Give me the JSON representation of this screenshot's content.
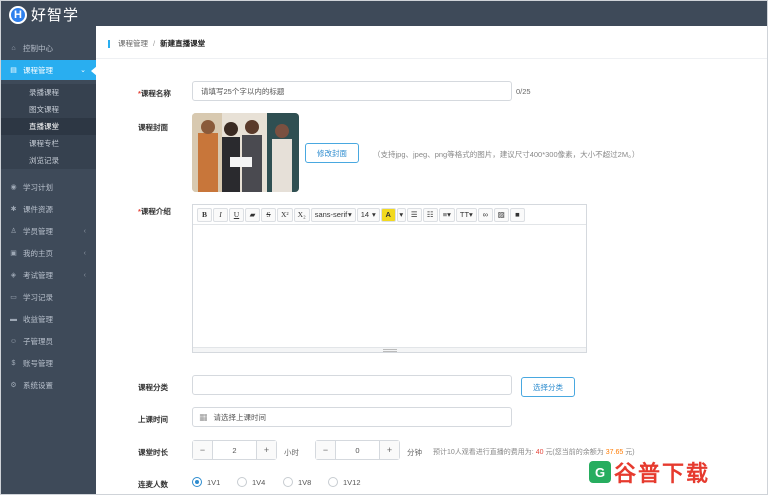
{
  "app": {
    "logo_letter": "H",
    "logo_text": "好智学"
  },
  "sidebar": {
    "items": [
      {
        "label": "控制中心",
        "icon": "home-icon"
      },
      {
        "label": "课程管理",
        "icon": "book-icon",
        "active": true
      },
      {
        "label": "学习计划",
        "icon": "eye-icon"
      },
      {
        "label": "课件资源",
        "icon": "gear-icon"
      },
      {
        "label": "学员管理",
        "icon": "user-icon"
      },
      {
        "label": "我的主页",
        "icon": "page-icon"
      },
      {
        "label": "考试管理",
        "icon": "tag-icon"
      },
      {
        "label": "学习记录",
        "icon": "monitor-icon"
      },
      {
        "label": "收益管理",
        "icon": "card-icon"
      },
      {
        "label": "子管理员",
        "icon": "person-icon"
      },
      {
        "label": "账号管理",
        "icon": "dollar-icon"
      },
      {
        "label": "系统设置",
        "icon": "settings-icon"
      }
    ],
    "subitems": [
      "录播课程",
      "图文课程",
      "直播课堂",
      "课程专栏",
      "浏览记录"
    ],
    "selected_sub": "直播课堂"
  },
  "breadcrumb": {
    "parent": "课程管理",
    "separator": "/",
    "current": "新建直播课堂"
  },
  "form": {
    "name_label": "*课程名称",
    "name_placeholder": "请填写25个字以内的标题",
    "name_count": "0/25",
    "cover_label": "课程封面",
    "cover_button": "修改封面",
    "cover_hint": "（支持jpg、jpeg、png等格式的图片，建议尺寸400*300像素，大小不超过2M。）",
    "intro_label": "*课程介绍",
    "toolbar": {
      "bold": "B",
      "italic": "I",
      "underline": "U",
      "eraser": "▰",
      "strike": "S",
      "sup": "X²",
      "sub": "X₂",
      "font": "sans-serif",
      "size": "14",
      "color": "A",
      "font_arrow": "▾"
    },
    "category_label": "课程分类",
    "category_button": "选择分类",
    "time_label": "上课时间",
    "time_placeholder": "请选择上课时间",
    "duration_label": "课堂时长",
    "hours_value": "2",
    "hours_unit": "小时",
    "minutes_value": "0",
    "minutes_unit": "分钟",
    "fee_text": "预计10人观看进行直播的费用为:",
    "fee_value": "40",
    "fee_mid": "元(您当前的余额为",
    "balance_value": "37.65",
    "fee_end": "元)",
    "connect_label": "连麦人数",
    "connect_options": [
      "1V1",
      "1V4",
      "1V8",
      "1V12"
    ],
    "connect_selected": "1V1"
  },
  "watermark": {
    "text": "谷普下载",
    "icon": "G"
  }
}
